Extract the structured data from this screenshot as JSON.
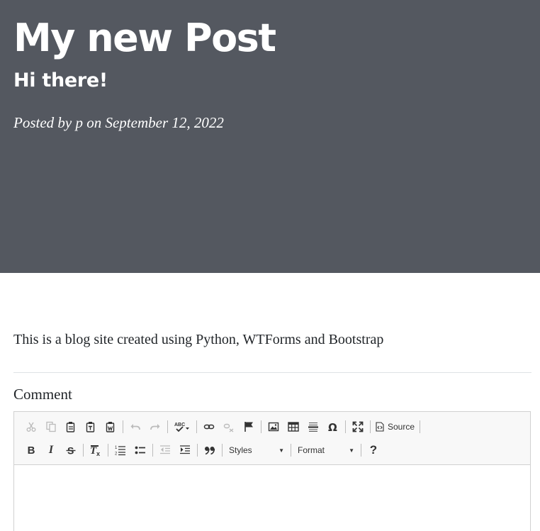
{
  "post": {
    "title": "My new Post",
    "subtitle": "Hi there!",
    "meta": "Posted by p on September 12, 2022"
  },
  "body_text": "This is a blog site created using Python, WTForms and Bootstrap",
  "comment": {
    "label": "Comment"
  },
  "editor": {
    "source_label": "Source",
    "styles_label": "Styles",
    "format_label": "Format",
    "bold_glyph": "B",
    "italic_glyph": "I",
    "help_glyph": "?",
    "toolbar_row1_icons": [
      "cut-icon",
      "copy-icon",
      "paste-icon",
      "paste-text-icon",
      "paste-from-word-icon",
      "undo-icon",
      "redo-icon",
      "spellcheck-icon",
      "link-icon",
      "unlink-icon",
      "anchor-icon",
      "image-icon",
      "table-icon",
      "horizontal-rule-icon",
      "special-char-icon",
      "maximize-icon",
      "source-icon"
    ],
    "toolbar_row2_icons": [
      "bold-icon",
      "italic-icon",
      "strike-icon",
      "remove-format-icon",
      "numbered-list-icon",
      "bulleted-list-icon",
      "outdent-icon",
      "indent-icon",
      "blockquote-icon",
      "help-icon"
    ]
  },
  "colors": {
    "masthead_bg": "#545860",
    "masthead_text": "#ffffff",
    "body_text": "#212529",
    "toolbar_bg": "#f8f8f8",
    "editor_border": "#d1d1d1"
  }
}
